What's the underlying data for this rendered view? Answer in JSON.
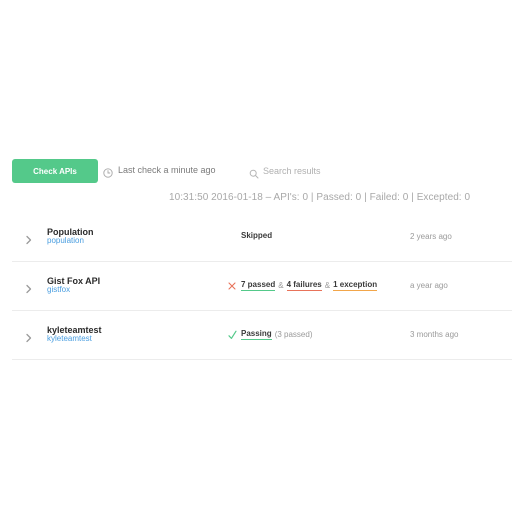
{
  "toolbar": {
    "check_button_label": "Check APIs",
    "last_check_text": "Last check a minute ago",
    "search_placeholder": "Search results"
  },
  "status_line": "10:31:50 2016-01-18 – API's: 0 | Passed: 0 | Failed: 0 | Excepted: 0",
  "apis": [
    {
      "name": "Population",
      "slug": "population",
      "status_text": "Skipped",
      "time": "2 years ago"
    },
    {
      "name": "Gist Fox API",
      "slug": "gistfox",
      "passed_label": "7 passed",
      "failures_label": "4 failures",
      "exception_label": "1 exception",
      "amp": "&",
      "time": "a year ago"
    },
    {
      "name": "kyleteamtest",
      "slug": "kyleteamtest",
      "passing_label": "Passing",
      "passing_count": "(3 passed)",
      "time": "3 months ago"
    }
  ],
  "colors": {
    "accent_green": "#54c98a",
    "link_blue": "#4a9ee0",
    "failure_red": "#e8735a",
    "exception_orange": "#f2a64a"
  },
  "icons": [
    "clock-icon",
    "search-icon",
    "chevron-right-icon",
    "x-icon",
    "check-icon"
  ]
}
